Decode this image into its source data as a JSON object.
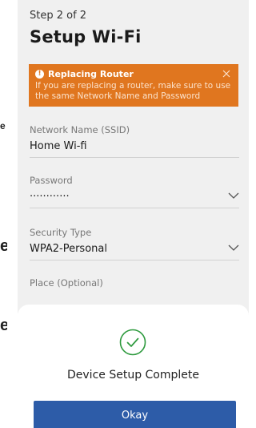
{
  "backdrop": {
    "fragments": [
      "e",
      "e",
      "e"
    ]
  },
  "header": {
    "step": "Step 2 of 2",
    "title": "Setup Wi-Fi"
  },
  "alert": {
    "title": "Replacing Router",
    "body": "If you are replacing a router, make sure to use the same Network Name and Password",
    "icon": "exclamation-icon",
    "color": "#e0761f"
  },
  "form": {
    "ssid": {
      "label": "Network Name (SSID)",
      "value": "Home Wi-fi"
    },
    "password": {
      "label": "Password",
      "value": "············"
    },
    "security": {
      "label": "Security Type",
      "value": "WPA2-Personal"
    },
    "place": {
      "label": "Place (Optional)"
    }
  },
  "dialog": {
    "message": "Device Setup Complete",
    "button_label": "Okay",
    "accent": "#2d5ca8",
    "success_color": "#2e9a3e"
  }
}
